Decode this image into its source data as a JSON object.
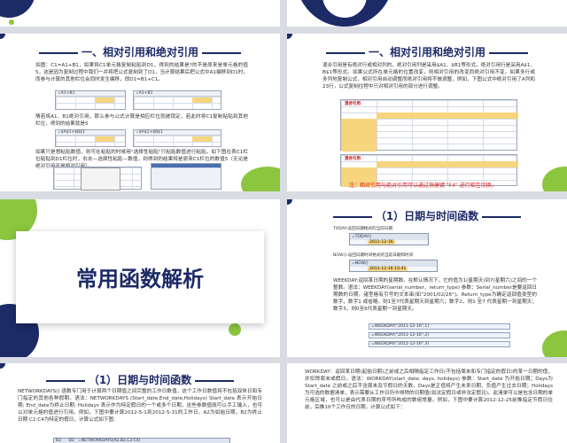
{
  "slide1": {
    "title": "一、相对引用和绝对引用",
    "para1": "如图：C1=A1+B1，如果将C1单元格复制粘贴到D1，得到的结果是?的不是原来是单元格的值5，这是因为复制过程中我们一并将把公式复制到了D1，当计算结果后把公式中A1编移到D1时，而参与计算的其他栏位会同时发生编移，即D1=B1+C1。",
    "para2": "情若将A1、B1绝对引用，那么参与公式计算是相应栏位就被锁定，若此时将C1复制粘贴到其他栏位，得到的结果就是5",
    "para3": "如果只是想粘贴数值，则可在粘贴的时候用\"选择性粘贴\"只粘贴数值进行粘贴，如下图在表C1栏位粘贴到D1栏位时，右击—选择性粘贴—数值，则得到的结果将是原来C1栏位的数值5（无论是绝对引用还是相对引用）。",
    "formula1": "=A1+B1",
    "formula2": "=$A$1+$B$1"
  },
  "slide2": {
    "title": "一、相对引用和绝对引用",
    "para1": "混合引用是有绝对行或相对列的，绝对引用列是采用$A1、$B1等形式。绝对引用行是采用A$1、B$1等形式。如果公式所在单元格的位置改变，则相对引用的改变而绝对引用不变。如果多行或多列地复制公式，相对引用自动调整而绝对引用将不做调整，例如，下图公式中绝对引用了A列和23行，公式复制往程中只对相对引用的部分进行调整。",
    "table_caption": "混合引用",
    "note": "注：相对引用与绝对引用可以通过快捷键 \"F4\" 进行相互切换。"
  },
  "slide3": {
    "title": "常用函数解析"
  },
  "slide4": {
    "title": "（1）日期与时间函数",
    "today_label": "TODAY:返回日期格式的当前日期",
    "today_formula": "=TODAY()",
    "today_value": "2011-12-16",
    "now_label": "NOW():返回日期时间格式的当前日期和时间",
    "now_formula": "=NOW()",
    "now_value": "2011-12-16 15:41",
    "weekday_text": "WEEKDAY:返回某日期的星期数。在默认情况下，它的值为1(星期天)到7(星期六)之间的一个整数。语法：WEEKDAY(serial_number，return_type) 参数：Serial_number是要返回日期数的日期，诸型格有引号的文本串(如\"2001/02/26\")。Return_type为确定返回值类型的数字，数字1 或省略，则1至7代表星期天到星期六；数字2，则1 至7 代表星期一到星期天；数字3，则0至6代表星期一到星期天。",
    "examples": [
      "=WEEKDAY(\"2011-12-16\",1)",
      "=WEEKDAY(\"2011-12-16\",2)",
      "=WEEKDAY(\"2011-12-16\",3)"
    ]
  },
  "slide5": {
    "title": "（1）日期与时间函数",
    "text": "NETWORKDAYS() 函数专门用于计算两个日期值之间完整的工作日数值，这个工作日数值将不包括双休日和专门指定的其他各种假期。语法：NETWORKDAYS (Start_date,End_date,Holidays) Start_date 表示开始日期; End_date为终止日期; Holidays 表示作为特定假日的一个或多个日期，这些参数值既可以手工输入，也可以对单元格的值进行引用。例如，下图中要计算2012-5-1到2012-5-31的工作日，A2为如始日期，B2为终止日期 C2:C4为特定的假日，计算公式如下图:",
    "formula": "=NETWORKDAYS(A2,B2,C2:C4)",
    "cells": [
      "B2",
      "D2"
    ]
  },
  "slide6": {
    "title": "（1）日期与时间函数",
    "text": "WORKDAY：返回某日期(起始日期)之前或之后相隔指定工作日(不包括周末和专门指定的假日)的某一日期的值，并扣除周末或假日。语法：WORKDAY(start_date, days, holidays) 参数：Start_date 为开始日期；Days为Start_date 之前或之后不含周末及节假日的天数，Days是正值将产生未来日期、负值产生过去日期；Holidays为可选的数据清单，表示需要从工作日历中排除的日期值(如法定假日或非法定假日)。此清单可以是包含日期的单元格区域，也可以是由代表日期的序号所构成的数组常量。例如，下图中要计算2012-12-25前推指定节假日往前，后推10个工作日的日期，计算公式如下："
  }
}
